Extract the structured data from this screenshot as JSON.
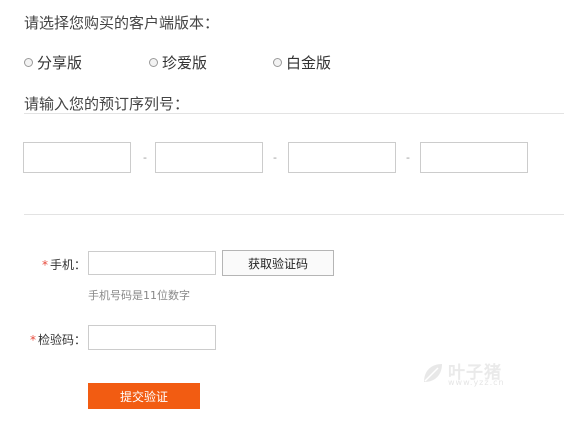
{
  "version_section": {
    "title": "请选择您购买的客户端版本：",
    "options": [
      {
        "label": "分享版"
      },
      {
        "label": "珍爱版"
      },
      {
        "label": "白金版"
      }
    ]
  },
  "serial_section": {
    "title": "请输入您的预订序列号：",
    "separator": "-"
  },
  "verify_form": {
    "required_mark": "*",
    "phone_label": "手机：",
    "get_code_button": "获取验证码",
    "phone_hint": "手机号码是11位数字",
    "code_label": "检验码：",
    "submit_button": "提交验证"
  },
  "watermark": {
    "main_text": "叶子猪",
    "sub_text": "www.yzz.cn"
  }
}
